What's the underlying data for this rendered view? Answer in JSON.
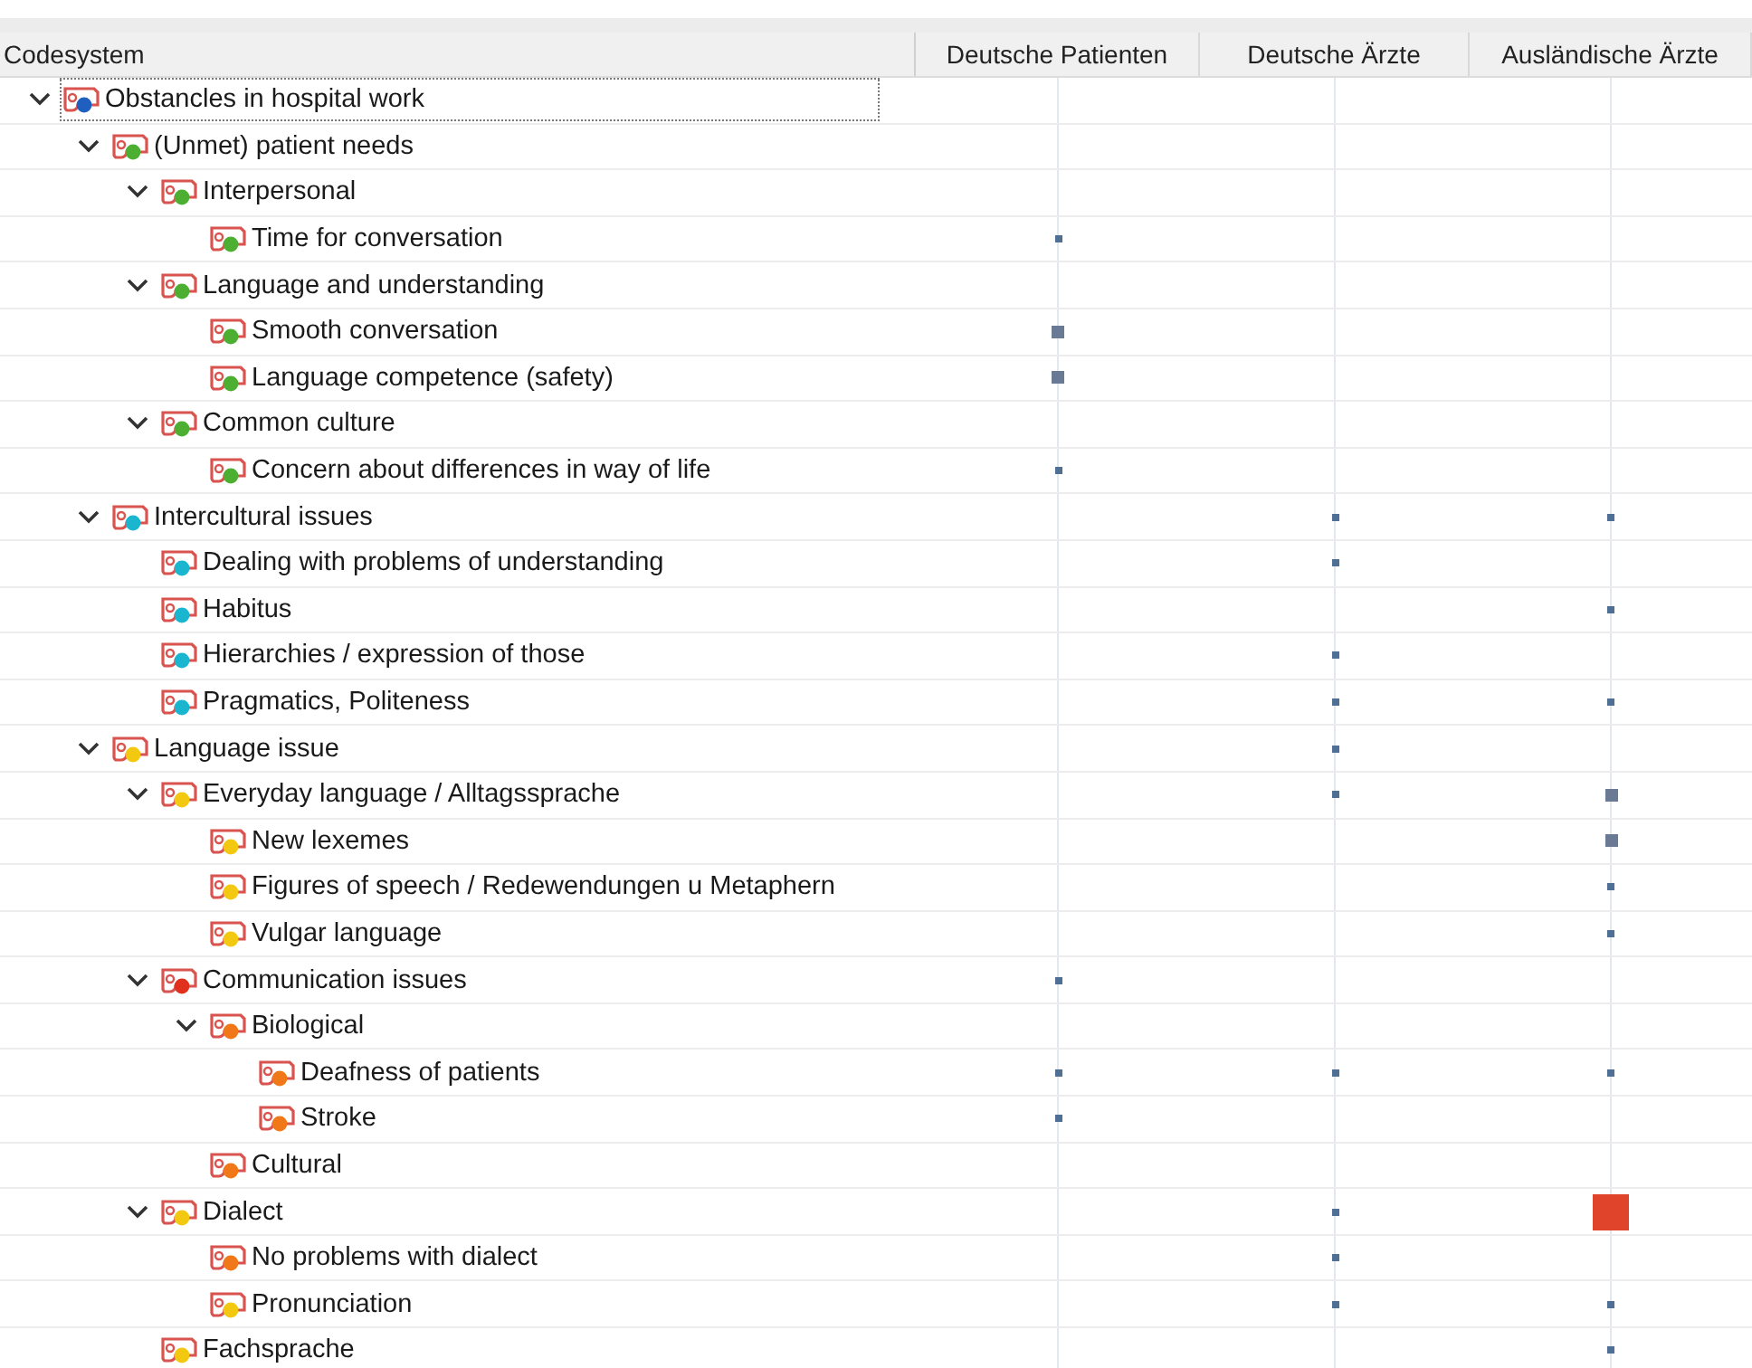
{
  "columns": [
    "Codesystem",
    "Deutsche Patienten",
    "Deutsche Ärzte",
    "Ausländische Ärzte"
  ],
  "codes": [
    {
      "label": "Obstancles in hospital work",
      "color": "#1f5fbf",
      "expanded": true,
      "selected": true,
      "cells": [
        {
          "kind": "none"
        },
        {
          "kind": "none"
        },
        {
          "kind": "none"
        }
      ],
      "children": [
        {
          "label": "(Unmet) patient needs",
          "color": "#4caf32",
          "expanded": true,
          "selected": false,
          "cells": [
            {
              "kind": "none"
            },
            {
              "kind": "none"
            },
            {
              "kind": "none"
            }
          ],
          "children": [
            {
              "label": "Interpersonal",
              "color": "#4caf32",
              "expanded": true,
              "selected": false,
              "cells": [
                {
                  "kind": "none"
                },
                {
                  "kind": "none"
                },
                {
                  "kind": "none"
                }
              ],
              "children": [
                {
                  "label": "Time for conversation",
                  "color": "#4caf32",
                  "selected": false,
                  "cells": [
                    {
                      "kind": "small"
                    },
                    {
                      "kind": "none"
                    },
                    {
                      "kind": "none"
                    }
                  ]
                }
              ]
            },
            {
              "label": "Language and understanding",
              "color": "#4caf32",
              "expanded": true,
              "selected": false,
              "cells": [
                {
                  "kind": "none"
                },
                {
                  "kind": "none"
                },
                {
                  "kind": "none"
                }
              ],
              "children": [
                {
                  "label": "Smooth conversation",
                  "color": "#4caf32",
                  "selected": false,
                  "cells": [
                    {
                      "kind": "medium"
                    },
                    {
                      "kind": "none"
                    },
                    {
                      "kind": "none"
                    }
                  ]
                },
                {
                  "label": "Language competence (safety)",
                  "color": "#4caf32",
                  "selected": false,
                  "cells": [
                    {
                      "kind": "medium"
                    },
                    {
                      "kind": "none"
                    },
                    {
                      "kind": "none"
                    }
                  ]
                }
              ]
            },
            {
              "label": "Common culture",
              "color": "#4caf32",
              "expanded": true,
              "selected": false,
              "cells": [
                {
                  "kind": "none"
                },
                {
                  "kind": "none"
                },
                {
                  "kind": "none"
                }
              ],
              "children": [
                {
                  "label": "Concern about differences in way of life",
                  "color": "#4caf32",
                  "selected": false,
                  "cells": [
                    {
                      "kind": "small"
                    },
                    {
                      "kind": "none"
                    },
                    {
                      "kind": "none"
                    }
                  ]
                }
              ]
            }
          ]
        },
        {
          "label": "Intercultural issues",
          "color": "#1ab6d0",
          "expanded": true,
          "selected": false,
          "cells": [
            {
              "kind": "none"
            },
            {
              "kind": "small"
            },
            {
              "kind": "small"
            }
          ],
          "children": [
            {
              "label": "Dealing with problems of understanding",
              "color": "#1ab6d0",
              "selected": false,
              "cells": [
                {
                  "kind": "none"
                },
                {
                  "kind": "small"
                },
                {
                  "kind": "none"
                }
              ]
            },
            {
              "label": "Habitus",
              "color": "#1ab6d0",
              "selected": false,
              "cells": [
                {
                  "kind": "none"
                },
                {
                  "kind": "none"
                },
                {
                  "kind": "small"
                }
              ]
            },
            {
              "label": "Hierarchies / expression of those",
              "color": "#1ab6d0",
              "selected": false,
              "cells": [
                {
                  "kind": "none"
                },
                {
                  "kind": "small"
                },
                {
                  "kind": "none"
                }
              ]
            },
            {
              "label": "Pragmatics, Politeness",
              "color": "#1ab6d0",
              "selected": false,
              "cells": [
                {
                  "kind": "none"
                },
                {
                  "kind": "small"
                },
                {
                  "kind": "small"
                }
              ]
            }
          ]
        },
        {
          "label": "Language issue",
          "color": "#f2c811",
          "expanded": true,
          "selected": false,
          "cells": [
            {
              "kind": "none"
            },
            {
              "kind": "small"
            },
            {
              "kind": "none"
            }
          ],
          "children": [
            {
              "label": "Everyday language / Alltagssprache",
              "color": "#f2c811",
              "expanded": true,
              "selected": false,
              "cells": [
                {
                  "kind": "none"
                },
                {
                  "kind": "small"
                },
                {
                  "kind": "medium"
                }
              ],
              "children": [
                {
                  "label": "New lexemes",
                  "color": "#f2c811",
                  "selected": false,
                  "cells": [
                    {
                      "kind": "none"
                    },
                    {
                      "kind": "none"
                    },
                    {
                      "kind": "medium"
                    }
                  ]
                },
                {
                  "label": "Figures of speech / Redewendungen u Metaphern",
                  "color": "#f2c811",
                  "selected": false,
                  "cells": [
                    {
                      "kind": "none"
                    },
                    {
                      "kind": "none"
                    },
                    {
                      "kind": "small"
                    }
                  ]
                },
                {
                  "label": "Vulgar language",
                  "color": "#f2c811",
                  "selected": false,
                  "cells": [
                    {
                      "kind": "none"
                    },
                    {
                      "kind": "none"
                    },
                    {
                      "kind": "small"
                    }
                  ]
                }
              ]
            },
            {
              "label": "Communication issues",
              "color": "#e0301e",
              "expanded": true,
              "selected": false,
              "cells": [
                {
                  "kind": "small"
                },
                {
                  "kind": "none"
                },
                {
                  "kind": "none"
                }
              ],
              "children": [
                {
                  "label": "Biological",
                  "color": "#f07818",
                  "expanded": true,
                  "selected": false,
                  "cells": [
                    {
                      "kind": "none"
                    },
                    {
                      "kind": "none"
                    },
                    {
                      "kind": "none"
                    }
                  ],
                  "children": [
                    {
                      "label": "Deafness of patients",
                      "color": "#f07818",
                      "selected": false,
                      "cells": [
                        {
                          "kind": "small"
                        },
                        {
                          "kind": "small"
                        },
                        {
                          "kind": "small"
                        }
                      ]
                    },
                    {
                      "label": "Stroke",
                      "color": "#f07818",
                      "selected": false,
                      "cells": [
                        {
                          "kind": "small"
                        },
                        {
                          "kind": "none"
                        },
                        {
                          "kind": "none"
                        }
                      ]
                    }
                  ]
                },
                {
                  "label": "Cultural",
                  "color": "#f07818",
                  "selected": false,
                  "cells": [
                    {
                      "kind": "none"
                    },
                    {
                      "kind": "none"
                    },
                    {
                      "kind": "none"
                    }
                  ]
                }
              ]
            },
            {
              "label": "Dialect",
              "color": "#f2c811",
              "expanded": true,
              "selected": false,
              "cells": [
                {
                  "kind": "none"
                },
                {
                  "kind": "small"
                },
                {
                  "kind": "large"
                }
              ],
              "children": [
                {
                  "label": "No problems with dialect",
                  "color": "#f07818",
                  "selected": false,
                  "cells": [
                    {
                      "kind": "none"
                    },
                    {
                      "kind": "small"
                    },
                    {
                      "kind": "none"
                    }
                  ]
                },
                {
                  "label": "Pronunciation",
                  "color": "#f2c811",
                  "selected": false,
                  "cells": [
                    {
                      "kind": "none"
                    },
                    {
                      "kind": "small"
                    },
                    {
                      "kind": "small"
                    }
                  ]
                }
              ]
            },
            {
              "label": "Fachsprache",
              "color": "#f2c811",
              "selected": false,
              "cells": [
                {
                  "kind": "none"
                },
                {
                  "kind": "none"
                },
                {
                  "kind": "small"
                }
              ]
            }
          ]
        }
      ]
    }
  ]
}
